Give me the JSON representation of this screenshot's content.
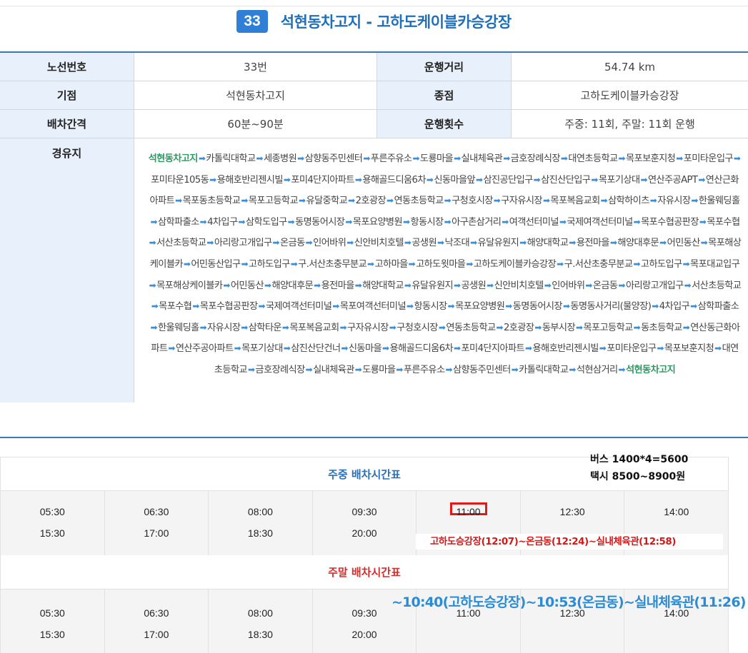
{
  "header": {
    "route_number": "33",
    "route_name": "석현동차고지 - 고하도케이블카승강장"
  },
  "info": {
    "route_no_label": "노선번호",
    "route_no_value": "33번",
    "distance_label": "운행거리",
    "distance_value": "54.74 km",
    "start_label": "기점",
    "start_value": "석현동차고지",
    "end_label": "종점",
    "end_value": "고하도케이블카승강장",
    "interval_label": "배차간격",
    "interval_value": "60분~90분",
    "trips_label": "운행횟수",
    "trips_value": "주중: 11회, 주말: 11회 운행",
    "via_label": "경유지"
  },
  "via_stops": [
    "석현동차고지",
    "카톨릭대학교",
    "세종병원",
    "삼향동주민센터",
    "푸른주유소",
    "도룡마을",
    "실내체육관",
    "금호장례식장",
    "대연초등학교",
    "목포보훈지청",
    "포미타운입구",
    "포미타운105동",
    "용해호반리젠시빌",
    "포미4단지아파트",
    "용해골드디움6차",
    "신동마을앞",
    "삼진공단입구",
    "삼진산단입구",
    "목포기상대",
    "연산주공APT",
    "연산근화아파트",
    "목포동초등학교",
    "목포고등학교",
    "유달중학교",
    "2호광장",
    "연동초등학교",
    "구청호시장",
    "구자유시장",
    "목포복음교회",
    "삼학하이츠",
    "자유시장",
    "한울웨딩홀",
    "삼학파출소",
    "4차입구",
    "삼학도입구",
    "동명동어시장",
    "목포요양병원",
    "항동시장",
    "아구촌삼거리",
    "여객선터미널",
    "국제여객선터미널",
    "목포수협공판장",
    "목포수협",
    "서산초등학교",
    "아리랑고개입구",
    "온금동",
    "인어바위",
    "신안비치호텔",
    "공생원",
    "낙조대",
    "유달유원지",
    "해양대학교",
    "용전마을",
    "해양대후문",
    "어민동산",
    "목포해상케이블카",
    "어민동산입구",
    "고하도입구",
    "구.서산초충무분교",
    "고하마을",
    "고하도윗마을",
    "고하도케이블카승강장",
    "구.서산초충무분교",
    "고하도입구",
    "목포대교입구",
    "목포해상케이블카",
    "어민동산",
    "해양대후문",
    "용전마을",
    "해양대학교",
    "유달유원지",
    "공생원",
    "신안비치호텔",
    "인어바위",
    "온금동",
    "아리랑고개입구",
    "서산초등학교",
    "목포수협",
    "목포수협공판장",
    "국제여객선터미널",
    "목포여객선터미널",
    "항동시장",
    "목포요양병원",
    "동명동어시장",
    "동명동사거리(물양장)",
    "4차입구",
    "삼학파출소",
    "한울웨딩홀",
    "자유시장",
    "삼학타운",
    "목포복음교회",
    "구자유시장",
    "구청호시장",
    "연동초등학교",
    "2호광장",
    "동부시장",
    "목포고등학교",
    "동초등학교",
    "연산동근화아파트",
    "연산주공아파트",
    "목포기상대",
    "삼진산단건너",
    "신동마을",
    "용해골드디움6차",
    "포미4단지아파트",
    "용해호반리젠시빌",
    "포미타운입구",
    "목포보훈지청",
    "대연초등학교",
    "금호장례식장",
    "실내체육관",
    "도룡마을",
    "푸른주유소",
    "삼향동주민센터",
    "카톨릭대학교",
    "석현삼거리",
    "석현동차고지"
  ],
  "weekday": {
    "title": "주중 배차시간표",
    "columns": [
      [
        "05:30",
        "15:30"
      ],
      [
        "06:30",
        "17:00"
      ],
      [
        "08:00",
        "18:30"
      ],
      [
        "09:30",
        "20:00"
      ],
      [
        "11:00",
        ""
      ],
      [
        "12:30",
        ""
      ],
      [
        "14:00",
        ""
      ]
    ]
  },
  "weekend": {
    "title": "주말 배차시간표",
    "columns": [
      [
        "05:30",
        "15:30"
      ],
      [
        "06:30",
        "17:00"
      ],
      [
        "08:00",
        "18:30"
      ],
      [
        "09:30",
        "20:00"
      ],
      [
        "11:00",
        ""
      ],
      [
        "12:30",
        ""
      ],
      [
        "14:00",
        ""
      ]
    ]
  },
  "notes": {
    "fare_bus": "버스 1400*4=5600",
    "fare_taxi": "택시 8500~8900원",
    "red_note": "고하도승강장(12:07)~온금동(12:24)~실내체육관(12:58)",
    "blue_note": "~10:40(고하도승강장)~10:53(온금동)~실내체육관(11:26)"
  },
  "colors": {
    "accent": "#2f7fd6",
    "title": "#1f6fb9",
    "header_bg": "#e8f0fb",
    "stop_highlight": "#2a9a62",
    "weekend_red": "#d12f2f",
    "highlight_box": "#e01a1a"
  }
}
